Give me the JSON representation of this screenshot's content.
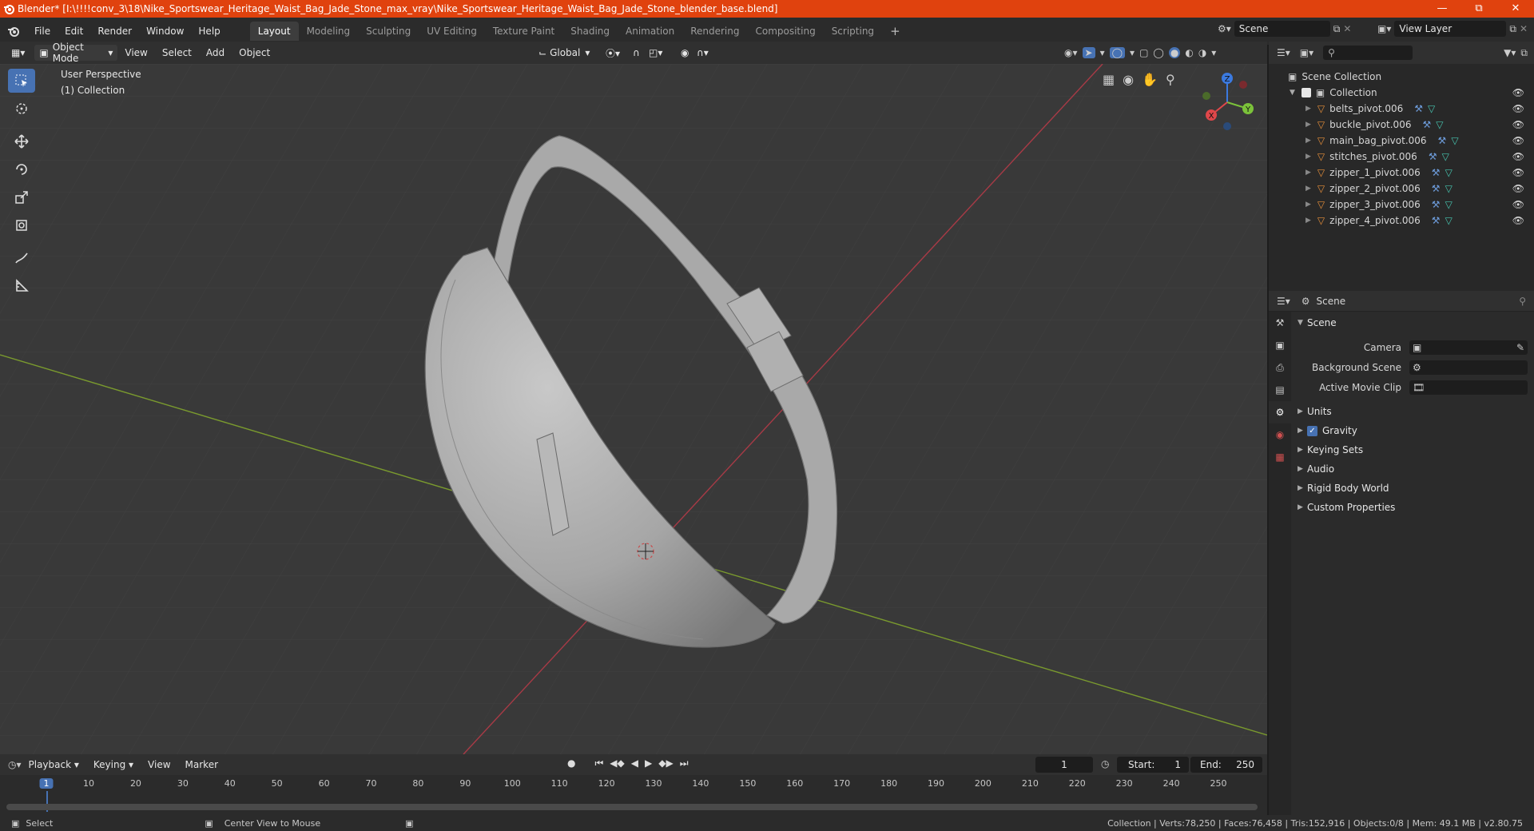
{
  "window": {
    "title": "Blender* [I:\\!!!!conv_3\\18\\Nike_Sportswear_Heritage_Waist_Bag_Jade_Stone_max_vray\\Nike_Sportswear_Heritage_Waist_Bag_Jade_Stone_blender_base.blend]"
  },
  "menu": [
    "File",
    "Edit",
    "Render",
    "Window",
    "Help"
  ],
  "workspaces": [
    "Layout",
    "Modeling",
    "Sculpting",
    "UV Editing",
    "Texture Paint",
    "Shading",
    "Animation",
    "Rendering",
    "Compositing",
    "Scripting"
  ],
  "scene_field": "Scene",
  "view_layer_field": "View Layer",
  "viewport_header": {
    "mode": "Object Mode",
    "menus": [
      "View",
      "Select",
      "Add",
      "Object"
    ],
    "transform": "Global"
  },
  "viewport": {
    "perspective": "User Perspective",
    "collection": "(1) Collection",
    "gizmo": {
      "x": "X",
      "y": "Y",
      "z": "Z"
    }
  },
  "outliner": {
    "root": "Scene Collection",
    "collection": "Collection",
    "items": [
      "belts_pivot.006",
      "buckle_pivot.006",
      "main_bag_pivot.006",
      "stitches_pivot.006",
      "zipper_1_pivot.006",
      "zipper_2_pivot.006",
      "zipper_3_pivot.006",
      "zipper_4_pivot.006"
    ]
  },
  "properties": {
    "header": "Scene",
    "panel": "Scene",
    "rows": [
      {
        "label": "Camera",
        "value": ""
      },
      {
        "label": "Background Scene",
        "value": ""
      },
      {
        "label": "Active Movie Clip",
        "value": ""
      }
    ],
    "sections": [
      "Units",
      "Gravity",
      "Keying Sets",
      "Audio",
      "Rigid Body World",
      "Custom Properties"
    ]
  },
  "timeline": {
    "menus": [
      "Playback",
      "Keying",
      "View",
      "Marker"
    ],
    "current_frame": "1",
    "start_label": "Start:",
    "start": "1",
    "end_label": "End:",
    "end": "250",
    "ticks": [
      "1",
      "10",
      "20",
      "30",
      "40",
      "50",
      "60",
      "70",
      "80",
      "90",
      "100",
      "110",
      "120",
      "130",
      "140",
      "150",
      "160",
      "170",
      "180",
      "190",
      "200",
      "210",
      "220",
      "230",
      "240",
      "250"
    ]
  },
  "status": {
    "left": "Select",
    "middle": "Center View to Mouse",
    "right": "Collection | Verts:78,250 | Faces:76,458 | Tris:152,916 | Objects:0/8 | Mem: 49.1 MB | v2.80.75"
  },
  "colors": {
    "accent": "#4772b3",
    "titlebar": "#e0420e",
    "object_icon": "#e78f3a",
    "mesh_icon": "#47c5b0"
  }
}
